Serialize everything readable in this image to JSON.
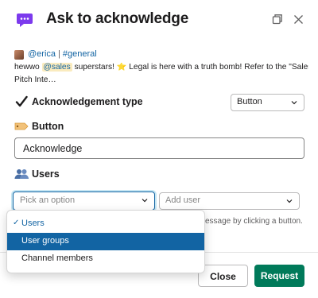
{
  "header": {
    "title": "Ask to acknowledge",
    "icons": [
      "app-speech-bubble-icon",
      "popout-icon",
      "close-icon"
    ]
  },
  "context": {
    "user_mention": "@erica",
    "channel_mention": "#general",
    "message_prefix": "hewwo ",
    "message_mention": "@sales",
    "message_rest": " superstars! ⭐ Legal is here with a truth bomb! Refer to the \"Sales",
    "message_line3": "Pitch Inte…"
  },
  "ack_type": {
    "label": "Acknowledgement type",
    "selected": "Button"
  },
  "button_section": {
    "label": "Button",
    "value": "Acknowledge"
  },
  "users_section": {
    "label": "Users",
    "pick_placeholder": "Pick an option",
    "add_user_placeholder": "Add user",
    "hint": "essage by clicking a button."
  },
  "dropdown": {
    "items": [
      {
        "label": "Users",
        "state": "selected"
      },
      {
        "label": "User groups",
        "state": "active"
      },
      {
        "label": "Channel members",
        "state": "normal"
      }
    ]
  },
  "footer": {
    "close_label": "Close",
    "request_label": "Request"
  },
  "colors": {
    "accent": "#1264a3",
    "primary_button": "#007a5a",
    "app_icon": "#7c3aed"
  }
}
